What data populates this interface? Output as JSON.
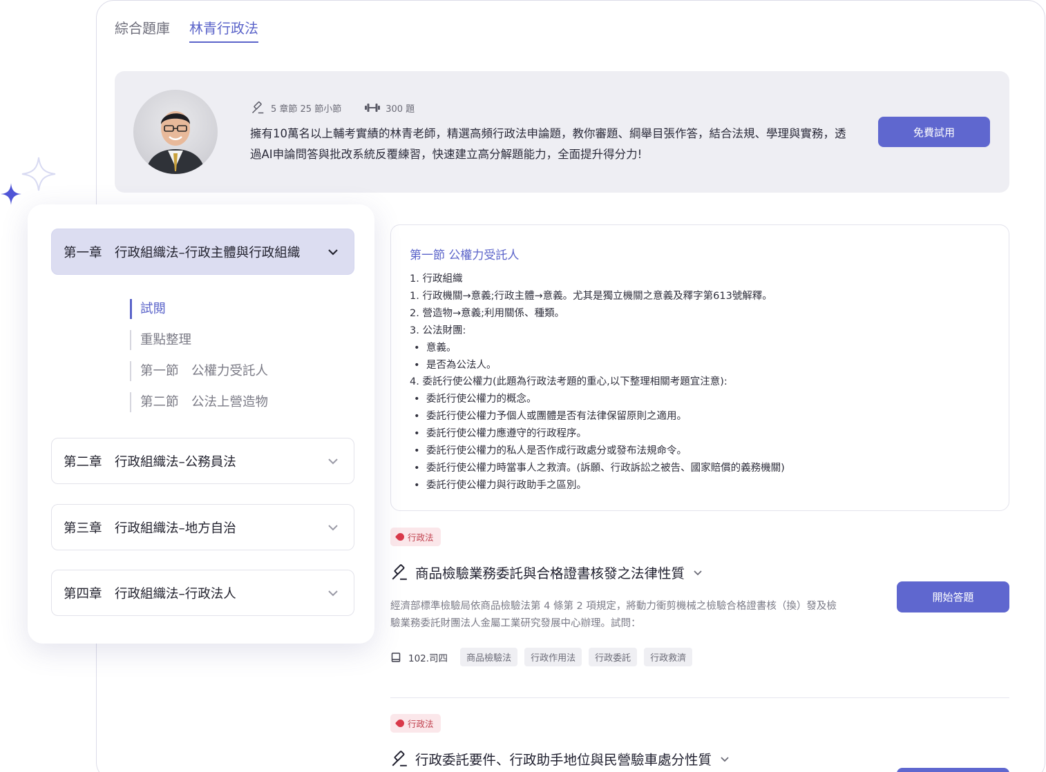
{
  "tabs": [
    {
      "label": "綜合題庫"
    },
    {
      "label": "林青行政法"
    }
  ],
  "banner": {
    "chapters_meta": "5 章節 25 節小節",
    "questions_meta": "300 題",
    "description": "擁有10萬名以上輔考實績的林青老師，精選高頻行政法申論題，教你審題、綱舉目張作答，結合法規、學理與實務，透過AI申論問答與批改系統反覆練習，快速建立高分解題能力，全面提升得分力!",
    "trial_button": "免費試用"
  },
  "sidebar": {
    "chapters": [
      {
        "label": "第一章　行政組織法–行政主體與行政組織"
      },
      {
        "label": "第二章　行政組織法–公務員法"
      },
      {
        "label": "第三章　行政組織法–地方自治"
      },
      {
        "label": "第四章　行政組織法–行政法人"
      }
    ],
    "subitems": [
      {
        "label": "試閱"
      },
      {
        "label": "重點整理"
      },
      {
        "label": "第一節　公權力受託人"
      },
      {
        "label": "第二節　公法上營造物"
      }
    ]
  },
  "content": {
    "title": "第一節 公權力受託人",
    "lines": [
      "1. 行政組織",
      "1. 行政機關→意義;行政主體→意義。尤其是獨立機關之意義及釋字第613號解釋。",
      "2. 營造物→意義;利用關係、種類。",
      "3. 公法財團:",
      "意義。",
      "是否為公法人。",
      "4. 委託行使公權力(此題為行政法考題的重心,以下整理相關考題宜注意):",
      "委託行使公權力的概念。",
      "委託行使公權力予個人或團體是否有法律保留原則之適用。",
      "委託行使公權力應遵守的行政程序。",
      "委託行使公權力的私人是否作成行政處分或發布法規命令。",
      "委託行使公權力時當事人之救濟。(訴願、行政訴訟之被告、國家賠償的義務機關)",
      "委託行使公權力與行政助手之區別。"
    ]
  },
  "questions": [
    {
      "tag": "行政法",
      "title": "商品檢驗業務委託與合格證書核發之法律性質",
      "description": "經濟部標準檢驗局依商品檢驗法第 4 條第 2 項規定，將動力衝剪機械之檢驗合格證書核（換）發及檢驗業務委託財團法人金屬工業研究發展中心辦理。試問：",
      "source": "102.司四",
      "keywords": [
        "商品檢驗法",
        "行政作用法",
        "行政委託",
        "行政救濟"
      ],
      "start_button": "開始答題"
    },
    {
      "tag": "行政法",
      "title": "行政委託要件、行政助手地位與民營驗車處分性質"
    }
  ],
  "colors": {
    "accent": "#5f67cf",
    "accent_text": "#5a63c9",
    "tag_bg": "#fbe7ea",
    "tag_text": "#c0424f"
  }
}
